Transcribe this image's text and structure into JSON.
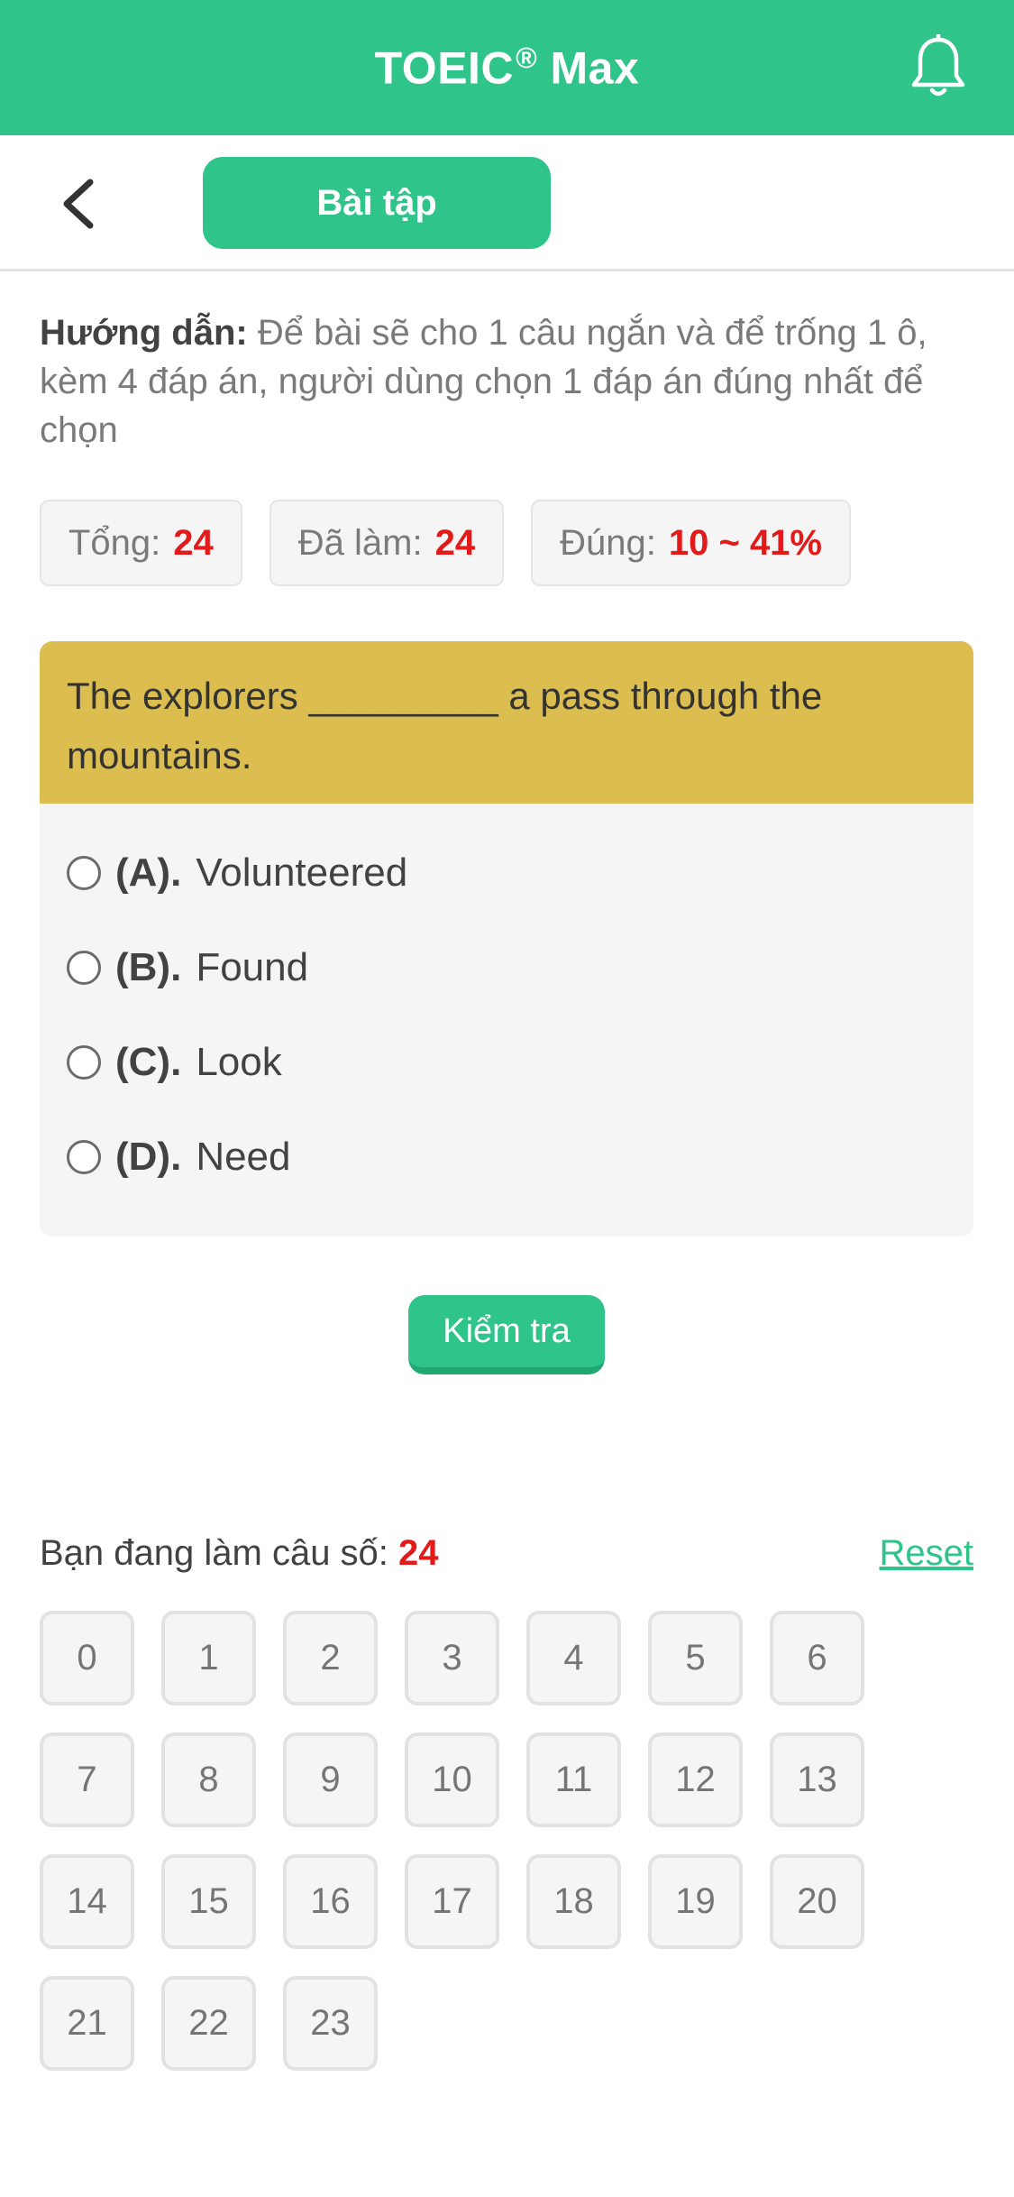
{
  "header": {
    "title": "TOEIC",
    "trademark": "®",
    "title_suffix": " Max"
  },
  "subbar": {
    "tab_label": "Bài tập"
  },
  "instructions": {
    "label": "Hướng dẫn:",
    "text": " Để bài sẽ cho 1 câu ngắn và để trống 1 ô, kèm 4 đáp án, người dùng chọn 1 đáp án đúng nhất để chọn"
  },
  "stats": {
    "total_label": "Tổng:",
    "total_value": "24",
    "done_label": "Đã làm:",
    "done_value": "24",
    "correct_label": "Đúng:",
    "correct_value": "10 ~ 41%"
  },
  "question": {
    "text": "The explorers _________ a pass through the mountains.",
    "options": [
      {
        "key": "(A).",
        "text": "Volunteered"
      },
      {
        "key": "(B).",
        "text": "Found"
      },
      {
        "key": "(C).",
        "text": "Look"
      },
      {
        "key": "(D).",
        "text": "Need"
      }
    ]
  },
  "check_button": {
    "label": "Kiểm tra"
  },
  "progress": {
    "current_label": "Bạn đang làm câu số: ",
    "current_value": "24",
    "reset_label": "Reset",
    "numbers": [
      "0",
      "1",
      "2",
      "3",
      "4",
      "5",
      "6",
      "7",
      "8",
      "9",
      "10",
      "11",
      "12",
      "13",
      "14",
      "15",
      "16",
      "17",
      "18",
      "19",
      "20",
      "21",
      "22",
      "23"
    ]
  },
  "colors": {
    "brand": "#2ec48a",
    "question_bg": "#dcbe50",
    "highlight": "#e31a1a"
  },
  "icons": {
    "header_right": "bell-icon",
    "back": "chevron-left-icon"
  }
}
